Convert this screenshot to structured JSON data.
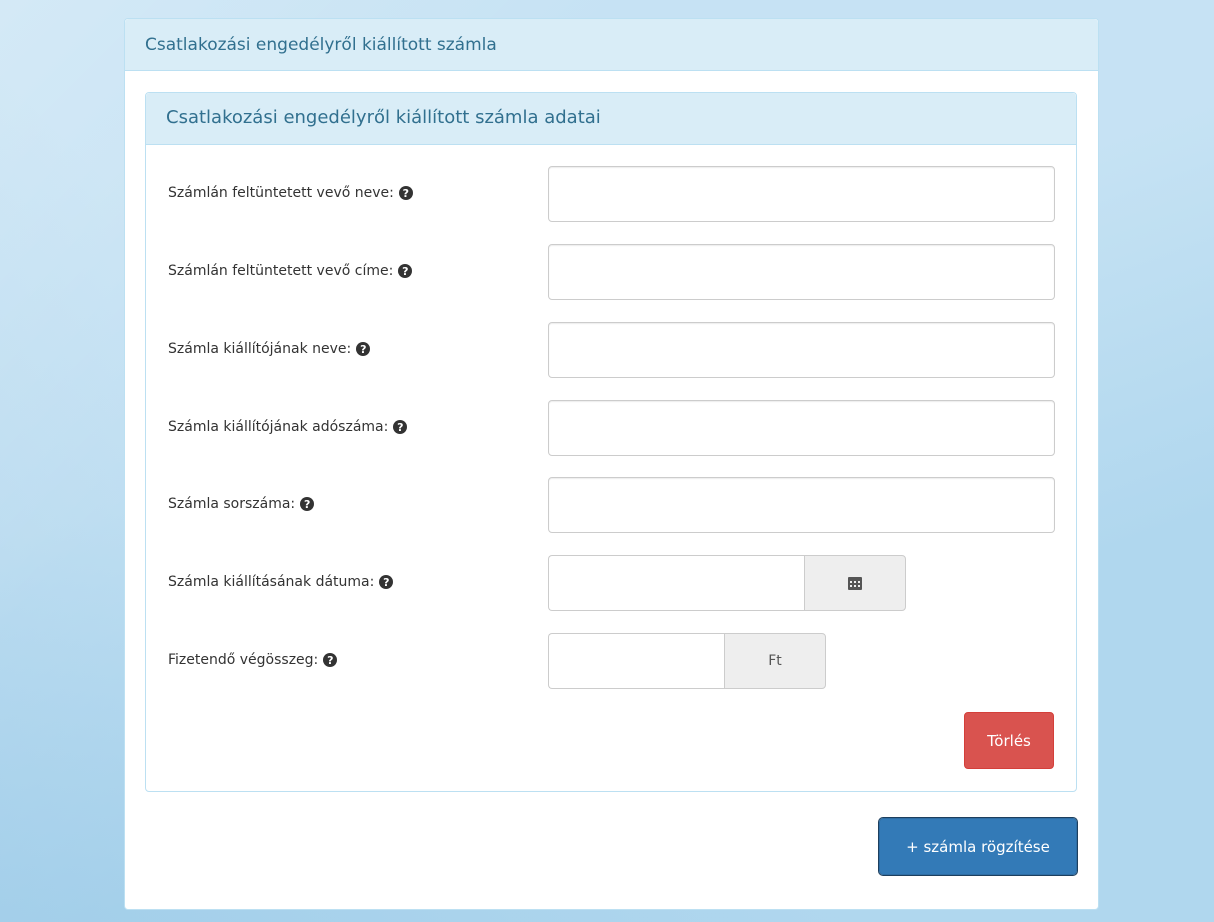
{
  "panel": {
    "title": "Csatlakozási engedélyről kiállított számla"
  },
  "subpanel": {
    "title": "Csatlakozási engedélyről kiállított számla adatai"
  },
  "fields": [
    {
      "label": "Számlán feltüntetett vevő neve:",
      "value": ""
    },
    {
      "label": "Számlán feltüntetett vevő címe:",
      "value": ""
    },
    {
      "label": "Számla kiállítójának neve:",
      "value": ""
    },
    {
      "label": "Számla kiállítójának adószáma:",
      "value": ""
    },
    {
      "label": "Számla sorszáma:",
      "value": ""
    },
    {
      "label": "Számla kiállításának dátuma:",
      "value": ""
    },
    {
      "label": "Fizetendő végösszeg:",
      "value": "",
      "addon": "Ft"
    }
  ],
  "help_icon": "question-circle-icon",
  "calendar_icon": "calendar-icon",
  "buttons": {
    "delete": "Törlés",
    "add": "+ számla rögzítése"
  },
  "colors": {
    "panel_header_bg": "#d9edf7",
    "panel_header_text": "#31708f",
    "delete_bg": "#d9534f",
    "primary_bg": "#337ab7"
  }
}
